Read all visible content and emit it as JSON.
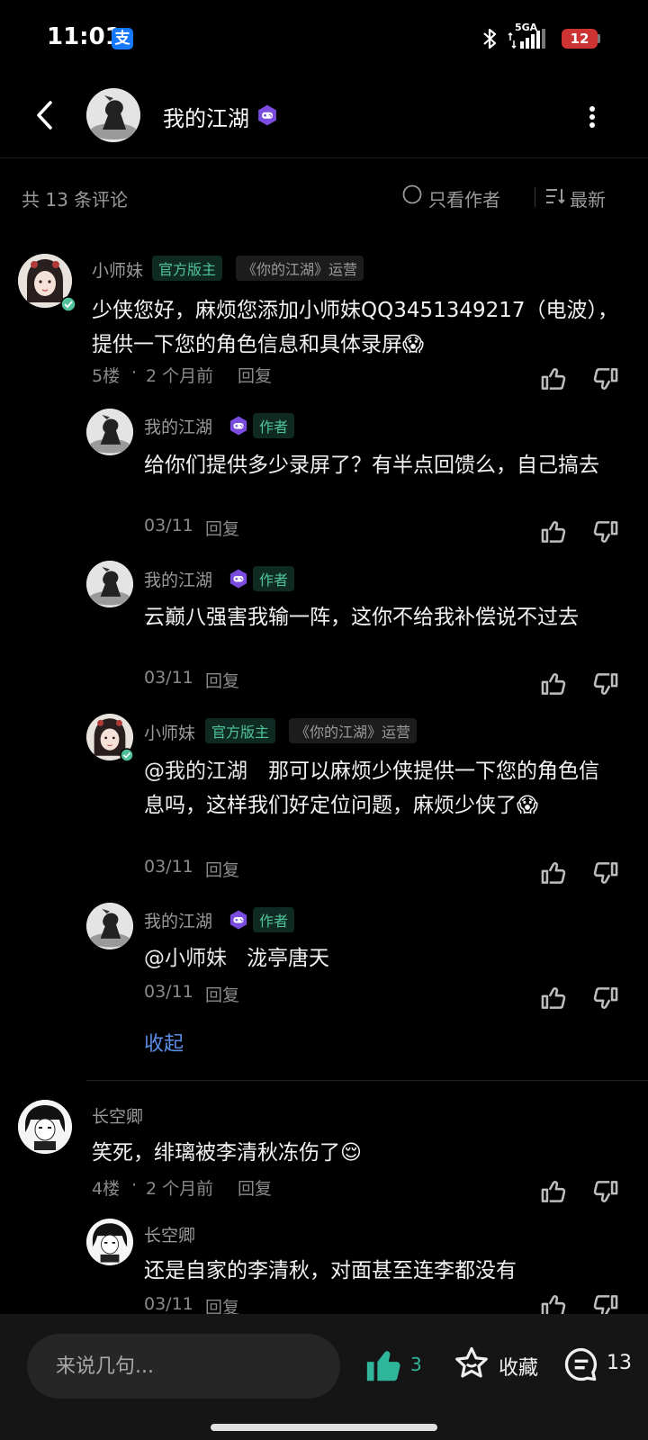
{
  "status_bar": {
    "time": "11:01",
    "alipay_glyph": "支",
    "network": "5GA",
    "battery": "12"
  },
  "header": {
    "title": "我的江湖"
  },
  "filter": {
    "count": "共 13 条评论",
    "author_only": "只看作者",
    "latest": "最新"
  },
  "comments": [
    {
      "user": "小师妹",
      "tag_official": "官方版主",
      "tag_ops": "《你的江湖》运营",
      "text": "少侠您好，麻烦您添加小师妹QQ3451349217（电波），提供一下您的角色信息和具体录屏😱",
      "floor": "5楼",
      "time": "2 个月前",
      "reply": "回复",
      "replies": [
        {
          "user": "我的江湖",
          "tag_author": "作者",
          "text": "给你们提供多少录屏了？有半点回馈么，自己搞去",
          "time": "03/11",
          "reply": "回复"
        },
        {
          "user": "我的江湖",
          "tag_author": "作者",
          "text": "云巅八强害我输一阵，这你不给我补偿说不过去",
          "time": "03/11",
          "reply": "回复"
        },
        {
          "user": "小师妹",
          "tag_official": "官方版主",
          "tag_ops": "《你的江湖》运营",
          "mention": "@我的江湖",
          "text": "那可以麻烦少侠提供一下您的角色信息吗，这样我们好定位问题，麻烦少侠了😱",
          "time": "03/11",
          "reply": "回复"
        },
        {
          "user": "我的江湖",
          "tag_author": "作者",
          "mention": "@小师妹",
          "text": "泷亭唐天",
          "time": "03/11",
          "reply": "回复"
        }
      ],
      "collapse": "收起"
    },
    {
      "user": "长空卿",
      "text": "笑死，绯璃被李清秋冻伤了😌",
      "floor": "4楼",
      "time": "2 个月前",
      "reply": "回复",
      "replies": [
        {
          "user": "长空卿",
          "text": "还是自家的李清秋，对面甚至连李都没有",
          "time": "03/11",
          "reply": "回复"
        }
      ]
    }
  ],
  "bottom_bar": {
    "input_placeholder": "来说几句...",
    "like_count": "3",
    "favorite_label": "收藏",
    "comment_count": "13"
  },
  "icons": [
    "back-arrow-icon",
    "more-icon",
    "game-badge-icon",
    "verified-icon",
    "radio-circle-icon",
    "sort-icon",
    "thumb-up-icon",
    "thumb-down-icon",
    "star-icon",
    "comment-bubble-icon"
  ],
  "colors": {
    "accent_green": "#4fc29a",
    "link_blue": "#5a8de6",
    "game_badge": "#7a4de0",
    "like_teal": "#2fb59a"
  }
}
